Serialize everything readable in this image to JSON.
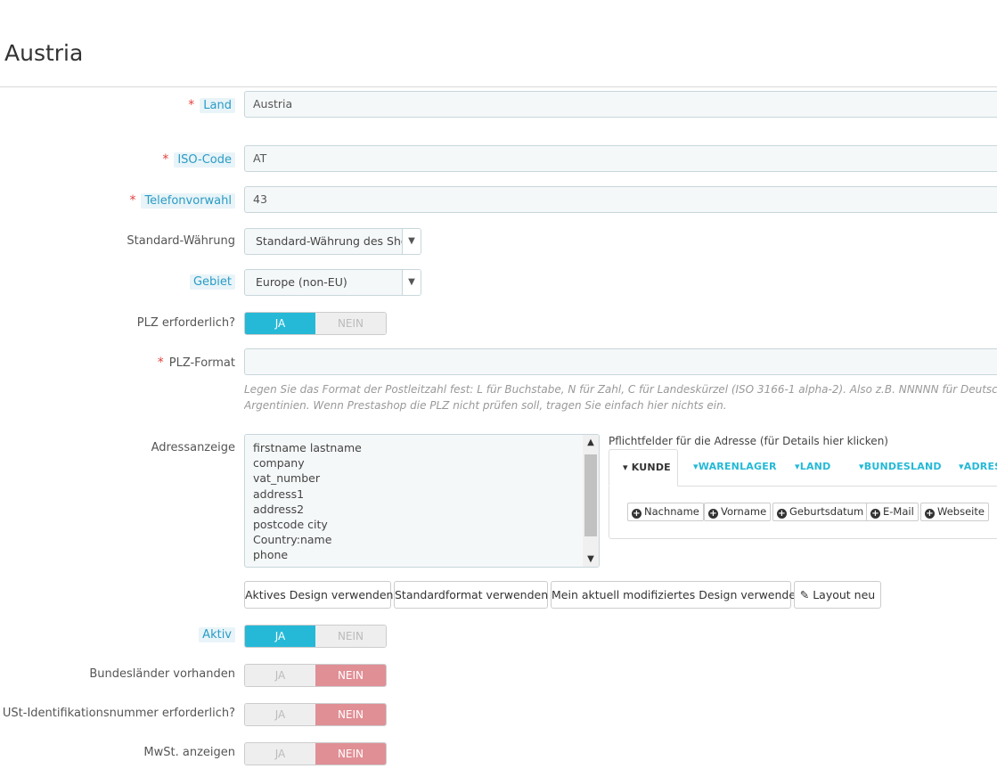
{
  "page": {
    "title": "Austria"
  },
  "fields": {
    "land": {
      "label": "Land",
      "value": "Austria"
    },
    "iso": {
      "label": "ISO-Code",
      "value": "AT"
    },
    "tel": {
      "label": "Telefonvorwahl",
      "value": "43"
    },
    "currency": {
      "label": "Standard-Währung",
      "value": "Standard-Währung des Shops"
    },
    "zone": {
      "label": "Gebiet",
      "value": "Europe (non-EU)"
    },
    "zip_required": {
      "label": "PLZ erforderlich?",
      "yes": "JA",
      "no": "NEIN",
      "selected": "JA"
    },
    "zip_format": {
      "label": "PLZ-Format",
      "value": "",
      "help_line1": "Legen Sie das Format der Postleitzahl fest: L für Buchstabe, N für Zahl, C für Landeskürzel (ISO 3166-1 alpha-2). Also z.B. NNNNN für Deutschland, Frank",
      "help_line2": "Argentinien. Wenn Prestashop die PLZ nicht prüfen soll, tragen Sie einfach hier nichts ein."
    },
    "address": {
      "label": "Adressanzeige",
      "lines": [
        "firstname lastname",
        "company",
        "vat_number",
        "address1",
        "address2",
        "postcode city",
        "Country:name",
        "phone"
      ],
      "required_title": "Pflichtfelder für die Adresse (für Details hier klicken)",
      "tabs": [
        "KUNDE",
        "WARENLAGER",
        "LAND",
        "BUNDESLAND",
        "ADRES"
      ],
      "tab_fields": [
        "Nachname",
        "Vorname",
        "Geburtsdatum",
        "E-Mail",
        "Webseite"
      ],
      "buttons": [
        "Aktives Design verwenden",
        "Standardformat verwenden",
        "Mein aktuell modifiziertes Design verwenden",
        "Layout neu"
      ]
    },
    "active": {
      "label": "Aktiv",
      "yes": "JA",
      "no": "NEIN",
      "selected": "JA"
    },
    "states": {
      "label": "Bundesländer vorhanden",
      "yes": "JA",
      "no": "NEIN",
      "selected": "NEIN"
    },
    "vat_required": {
      "label": "USt-Identifikationsnummer erforderlich?",
      "yes": "JA",
      "no": "NEIN",
      "selected": "NEIN"
    },
    "show_tax": {
      "label": "MwSt. anzeigen",
      "yes": "JA",
      "no": "NEIN",
      "selected": "NEIN"
    }
  },
  "colors": {
    "accent": "#25b9d7",
    "required": "#e4403d",
    "no_active": "#e08f95"
  }
}
